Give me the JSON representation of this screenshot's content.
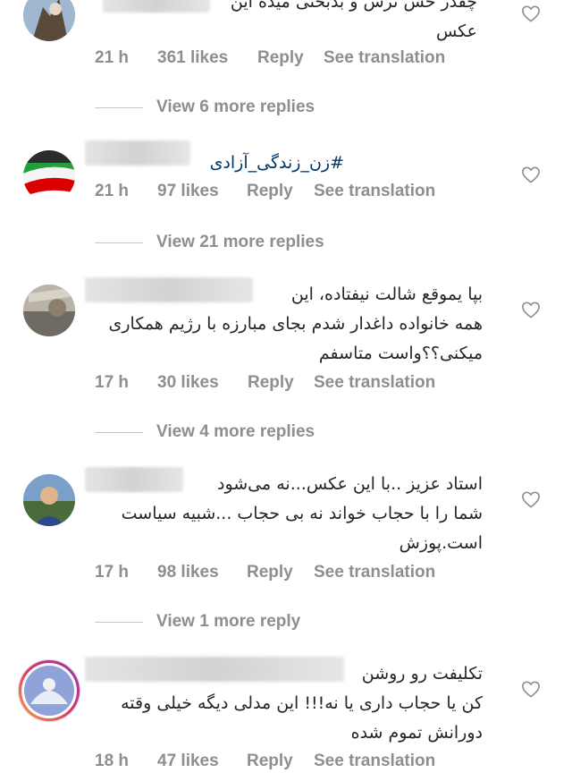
{
  "comments": [
    {
      "lines": [
        "چقدر حس ترس و بدبختی میده این",
        "عکس"
      ],
      "time": "21 h",
      "likes": "361 likes",
      "reply": "Reply",
      "translation": "See translation",
      "more_replies": "View 6 more replies"
    },
    {
      "lines": [
        "#زن_زندگی_آزادی"
      ],
      "time": "21 h",
      "likes": "97 likes",
      "reply": "Reply",
      "translation": "See translation",
      "more_replies": "View 21 more replies"
    },
    {
      "lines": [
        "بپا یموقع شالت نیفتاده، این",
        "همه خانواده داغدار شدم بجای مبارزه با رژیم همکاری",
        "میکنی؟؟واست متاسفم"
      ],
      "time": "17 h",
      "likes": "30 likes",
      "reply": "Reply",
      "translation": "See translation",
      "more_replies": "View 4 more replies"
    },
    {
      "lines": [
        "استاد عزیز ..با این عکس...نه می‌شود",
        "شما را با حجاب خواند نه بی حجاب ...شبیه سیاست",
        "است.پوزش"
      ],
      "time": "17 h",
      "likes": "98 likes",
      "reply": "Reply",
      "translation": "See translation",
      "more_replies": "View 1 more reply"
    },
    {
      "lines": [
        "تکلیفت رو روشن",
        "کن یا حجاب داری یا نه!!! این مدلی دیگه خیلی وقته",
        "دورانش تموم شده"
      ],
      "time": "18 h",
      "likes": "47 likes",
      "reply": "Reply",
      "translation": "See translation"
    }
  ],
  "icons": {
    "like": "heart-icon"
  },
  "colors": {
    "text": "#262626",
    "meta": "#8e8e8e",
    "hashtag": "#00376b"
  }
}
